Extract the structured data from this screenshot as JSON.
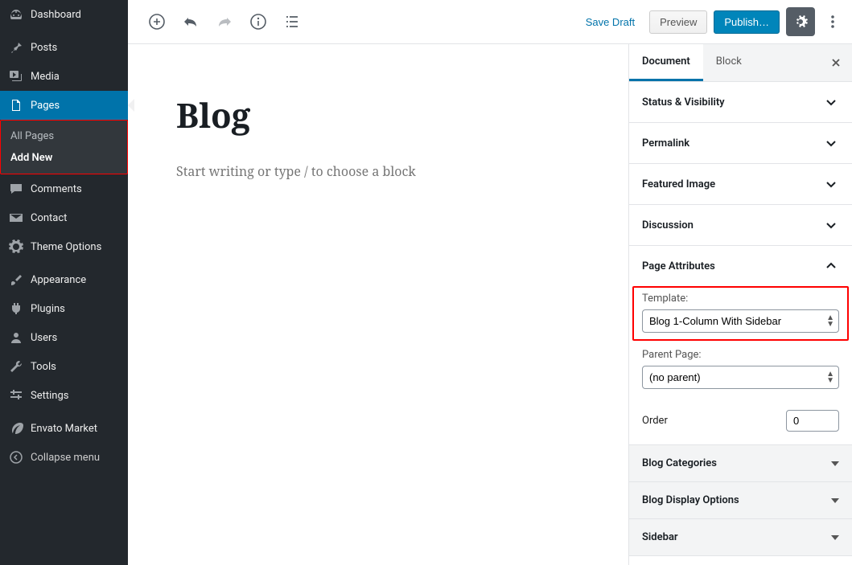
{
  "sidebar": {
    "dashboard": "Dashboard",
    "posts": "Posts",
    "media": "Media",
    "pages": "Pages",
    "pages_sub": {
      "all": "All Pages",
      "add": "Add New"
    },
    "comments": "Comments",
    "contact": "Contact",
    "theme_options": "Theme Options",
    "appearance": "Appearance",
    "plugins": "Plugins",
    "users": "Users",
    "tools": "Tools",
    "settings": "Settings",
    "envato": "Envato Market",
    "collapse": "Collapse menu"
  },
  "toolbar": {
    "save_draft": "Save Draft",
    "preview": "Preview",
    "publish": "Publish…"
  },
  "editor": {
    "title": "Blog",
    "placeholder": "Start writing or type / to choose a block"
  },
  "rightpanel": {
    "tab_document": "Document",
    "tab_block": "Block",
    "sections": {
      "status": "Status & Visibility",
      "permalink": "Permalink",
      "featured": "Featured Image",
      "discussion": "Discussion",
      "attrs": "Page Attributes",
      "blog_cats": "Blog Categories",
      "blog_display": "Blog Display Options",
      "sidebar": "Sidebar"
    },
    "attrs": {
      "template_label": "Template:",
      "template_value": "Blog 1-Column With Sidebar",
      "parent_label": "Parent Page:",
      "parent_value": "(no parent)",
      "order_label": "Order",
      "order_value": "0"
    }
  }
}
